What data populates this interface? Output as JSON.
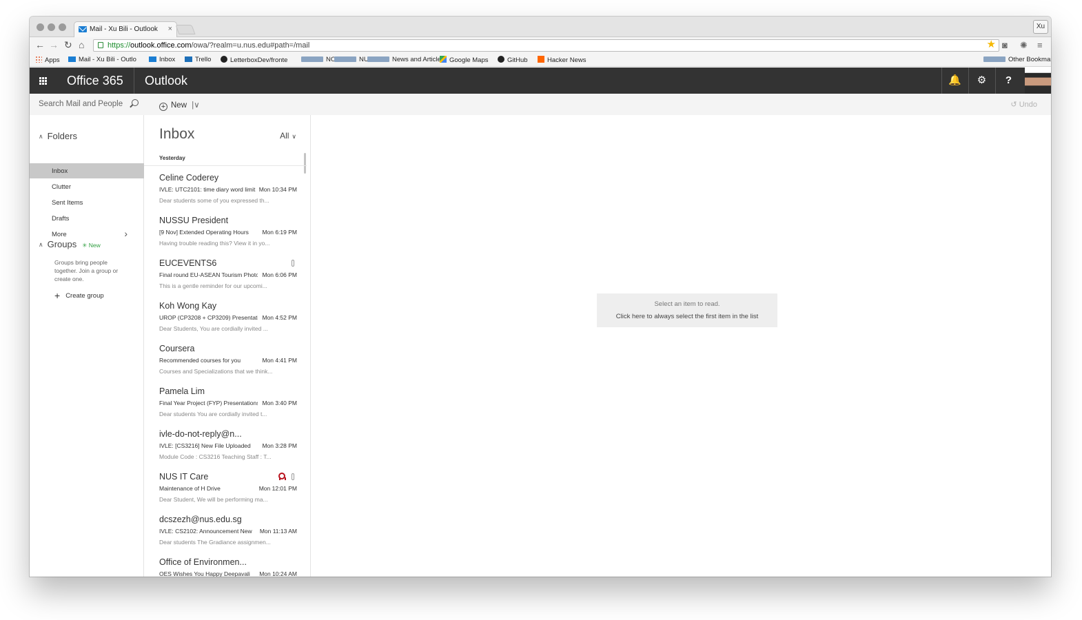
{
  "browser": {
    "tab_title": "Mail - Xu Bili - Outlook",
    "tab_close": "×",
    "profile_label": "Xu",
    "url": {
      "scheme": "https://",
      "domain": "outlook.office.com",
      "path": "/owa/?realm=u.nus.edu#path=/mail"
    },
    "bookmarks": [
      {
        "label": "Apps",
        "icon": "apps-grid-icon"
      },
      {
        "label": "Mail - Xu Bili - Outlo",
        "icon": "mail-icon"
      },
      {
        "label": "Inbox",
        "icon": "inbox-mail-icon"
      },
      {
        "label": "Trello",
        "icon": "trello-icon"
      },
      {
        "label": "LetterboxDev/fronte",
        "icon": "github-icon"
      },
      {
        "label": "NOC",
        "icon": "folder-icon"
      },
      {
        "label": "NUS",
        "icon": "folder-icon"
      },
      {
        "label": "News and Articles",
        "icon": "folder-icon"
      },
      {
        "label": "Google Maps",
        "icon": "google-maps-icon"
      },
      {
        "label": "GitHub",
        "icon": "github-icon"
      },
      {
        "label": "Hacker News",
        "icon": "hacker-news-icon"
      }
    ],
    "other_bookmarks": "Other Bookmarks"
  },
  "suitebar": {
    "suite_title": "Office 365",
    "app_title": "Outlook",
    "bell": "🔔",
    "gear": "⚙",
    "help": "?"
  },
  "command_bar": {
    "search_placeholder": "Search Mail and People",
    "new_label": "New",
    "new_caret": "|∨",
    "undo_label": "Undo",
    "undo_glyph": "↺"
  },
  "folders": {
    "header": "Folders",
    "items": [
      {
        "label": "Inbox",
        "selected": true
      },
      {
        "label": "Clutter",
        "selected": false
      },
      {
        "label": "Sent Items",
        "selected": false
      },
      {
        "label": "Drafts",
        "selected": false
      },
      {
        "label": "More",
        "selected": false
      }
    ],
    "groups_header": "Groups",
    "groups_new": "New",
    "groups_desc": "Groups bring people together. Join a group or create one.",
    "create_group": "Create group"
  },
  "inbox": {
    "title": "Inbox",
    "filter": "All",
    "group_label": "Yesterday",
    "messages": [
      {
        "sender": "Celine Coderey",
        "subject": "IVLE: UTC2101: time diary word limit",
        "time": "Mon 10:34 PM",
        "preview": "Dear students some of you expressed th...",
        "attachment": false,
        "flag": false
      },
      {
        "sender": "NUSSU President",
        "subject": "[9 Nov] Extended Operating Hours",
        "time": "Mon 6:19 PM",
        "preview": "Having trouble reading this? View it in yo...",
        "attachment": false,
        "flag": false
      },
      {
        "sender": "EUCEVENTS6",
        "subject": "Final round EU-ASEAN Tourism Photo",
        "time": "Mon 6:06 PM",
        "preview": "This is a gentle reminder for our upcomi...",
        "attachment": true,
        "flag": false
      },
      {
        "sender": "Koh Wong Kay",
        "subject": "UROP (CP3208 + CP3209) Presentations",
        "time": "Mon 4:52 PM",
        "preview": "Dear Students,   You are cordially invited ...",
        "attachment": false,
        "flag": false
      },
      {
        "sender": "Coursera",
        "subject": "Recommended courses for you",
        "time": "Mon 4:41 PM",
        "preview": "Courses and Specializations that we think...",
        "attachment": false,
        "flag": false
      },
      {
        "sender": "Pamela Lim",
        "subject": "Final Year Project (FYP) Presentations",
        "time": "Mon 3:40 PM",
        "preview": "Dear students  You are cordially invited t...",
        "attachment": false,
        "flag": false
      },
      {
        "sender": "ivle-do-not-reply@n...",
        "subject": "IVLE: [CS3216] New File Uploaded",
        "time": "Mon 3:28 PM",
        "preview": "Module Code : CS3216 Teaching Staff : T...",
        "attachment": false,
        "flag": false
      },
      {
        "sender": "NUS IT Care",
        "subject": "Maintenance of H Drive",
        "time": "Mon 12:01 PM",
        "preview": "Dear Student,  We will be performing ma...",
        "attachment": true,
        "flag": true
      },
      {
        "sender": "dcszezh@nus.edu.sg",
        "subject": "IVLE: CS2102: Announcement New",
        "time": "Mon 11:13 AM",
        "preview": "Dear students  The Gradiance assignmen...",
        "attachment": false,
        "flag": false
      },
      {
        "sender": "Office of Environmen...",
        "subject": "OES Wishes You Happy Deepavali",
        "time": "Mon 10:24 AM",
        "preview": "",
        "attachment": false,
        "flag": false
      }
    ]
  },
  "reading_pane": {
    "hint_line1": "Select an item to read.",
    "hint_line2": "Click here to always select the first item in the list"
  }
}
